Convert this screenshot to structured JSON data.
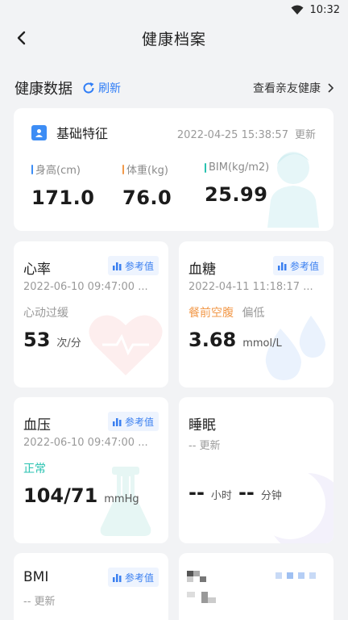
{
  "status": {
    "time": "10:32"
  },
  "nav": {
    "title": "健康档案"
  },
  "section": {
    "title": "健康数据",
    "refresh": "刷新",
    "family": "查看亲友健康"
  },
  "basic": {
    "title": "基础特征",
    "date": "2022-04-25 15:38:57",
    "update": "更新",
    "metrics": [
      {
        "label": "身高(cm)",
        "value": "171.0",
        "color": "#3d8df5"
      },
      {
        "label": "体重(kg)",
        "value": "76.0",
        "color": "#f2994a"
      },
      {
        "label": "BIM(kg/m2)",
        "value": "25.99",
        "color": "#27c2b0"
      }
    ]
  },
  "cards": {
    "ref_label": "参考值",
    "heart": {
      "title": "心率",
      "time": "2022-06-10 09:47:00 ...",
      "status": "心动过缓",
      "value": "53",
      "unit": "次/分"
    },
    "sugar": {
      "title": "血糖",
      "time": "2022-04-11 11:18:17 ...",
      "status": "餐前空腹",
      "status2": "偏低",
      "value": "3.68",
      "unit": "mmol/L"
    },
    "pressure": {
      "title": "血压",
      "time": "2022-06-10 09:47:00 ...",
      "status": "正常",
      "value": "104/71",
      "unit": "mmHg"
    },
    "sleep": {
      "title": "睡眠",
      "time": "-- 更新",
      "hours": "--",
      "hours_unit": "小时",
      "minutes": "--",
      "minutes_unit": "分钟"
    },
    "bmi": {
      "title": "BMI",
      "time": "-- 更新"
    }
  },
  "colors": {
    "accent": "#2f7df6",
    "orange": "#f2994a",
    "teal": "#27c2b0"
  }
}
